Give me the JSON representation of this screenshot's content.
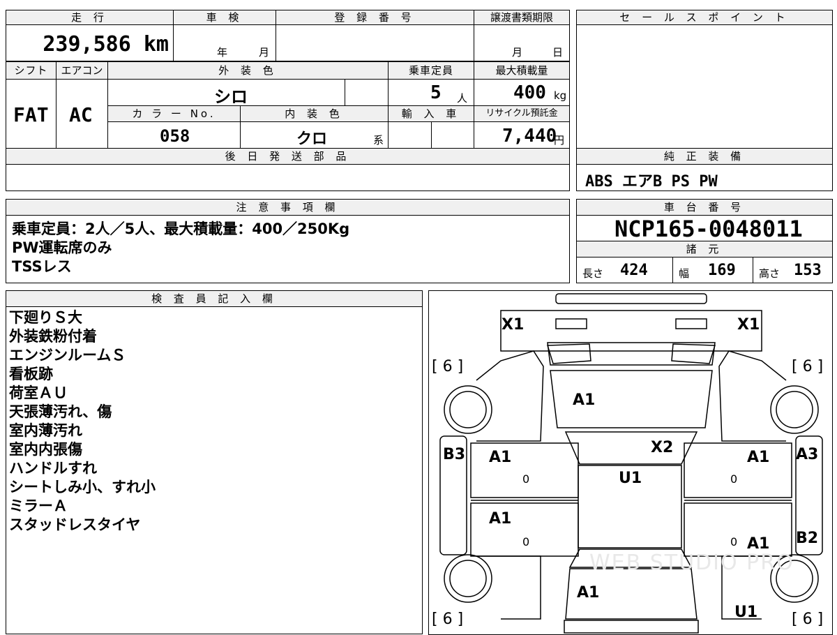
{
  "top": {
    "mileage_label": "走 行",
    "mileage_value": "239,586 km",
    "shaken_label": "車 検",
    "shaken_year": "年",
    "shaken_month": "月",
    "registration_label": "登 録 番 号",
    "transfer_label": "譲渡書類期限",
    "transfer_month": "月",
    "transfer_day": "日"
  },
  "specs": {
    "shift_label": "シフト",
    "shift_value": "FAT",
    "ac_label": "エアコン",
    "ac_value": "AC",
    "exterior_label": "外 装 色",
    "exterior_value": "シロ",
    "capacity_label": "乗車定員",
    "capacity_value": "5",
    "capacity_unit": "人",
    "load_label": "最大積載量",
    "load_value": "400",
    "load_unit": "kg",
    "color_no_label": "カ ラ ー No.",
    "color_no_value": "058",
    "interior_label": "内 装 色",
    "interior_value": "クロ",
    "interior_unit": "系",
    "import_label": "輸 入 車",
    "recycle_label": "リサイクル預託金",
    "recycle_value": "7,440",
    "recycle_unit": "円"
  },
  "sales_point_label": "セ ー ル ス ポ イ ン ト",
  "later_parts_label": "後 日 発 送 部 品",
  "genuine_label": "純 正 装 備",
  "genuine_value": "ABS エアB PS PW",
  "caution": {
    "label": "注 意 事 項 欄",
    "lines": [
      "乗車定員：2人／5人、最大積載量：400／250Kg",
      "PW運転席のみ",
      "TSSレス"
    ]
  },
  "chassis": {
    "label": "車 台 番 号",
    "value": "NCP165-0048011",
    "spec_label": "諸 元",
    "length_label": "長さ",
    "length_value": "424",
    "width_label": "幅",
    "width_value": "169",
    "height_label": "高さ",
    "height_value": "153"
  },
  "inspector": {
    "label": "検 査 員 記 入 欄",
    "lines": [
      "下廻りＳ大",
      "外装鉄粉付着",
      "エンジンルームＳ",
      "看板跡",
      "荷室ＡＵ",
      "天張薄汚れ、傷",
      "室内薄汚れ",
      "室内内張傷",
      "ハンドルすれ",
      "シートしみ小、すれ小",
      "ミラーＡ",
      "スタッドレスタイヤ"
    ]
  },
  "diagram": {
    "marks": {
      "front_left_x": "X1",
      "front_right_x": "X1",
      "tire_fl": "[ 6 ]",
      "tire_fr": "[ 6 ]",
      "tire_rl": "[ 6 ]",
      "tire_rr": "[ 6 ]",
      "hood": "A1",
      "windshield": "X2",
      "roof": "U1",
      "door_fl": "A1",
      "door_rl": "A1",
      "door_fr": "A1",
      "door_rr": "A1",
      "rocker_l": "B3",
      "rocker_r_front": "A3",
      "rocker_r_rear": "B2",
      "rear": "A1",
      "rear_bumper_r": "U1",
      "zero_fl": "0",
      "zero_rl": "0",
      "zero_fr": "0",
      "zero_rr": "0"
    },
    "watermark": "WEB STUDIO PRO"
  }
}
